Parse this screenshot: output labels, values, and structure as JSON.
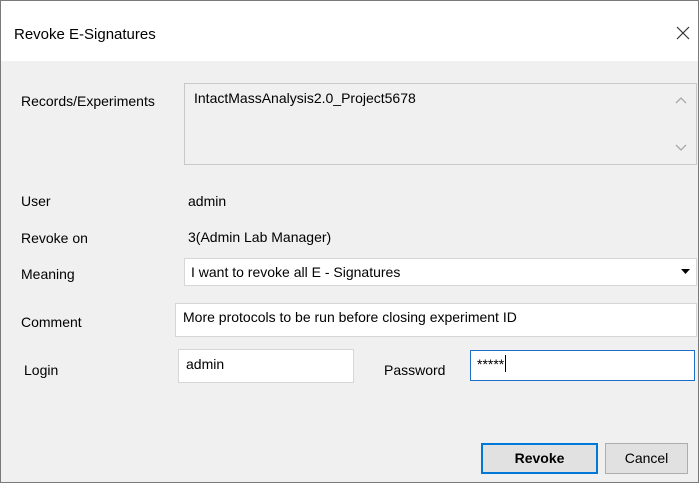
{
  "dialog": {
    "title": "Revoke E-Signatures"
  },
  "fields": {
    "records_label": "Records/Experiments",
    "records_value": "IntactMassAnalysis2.0_Project5678",
    "user_label": "User",
    "user_value": "admin",
    "revoke_on_label": "Revoke on",
    "revoke_on_value": "3(Admin Lab Manager)",
    "meaning_label": "Meaning",
    "meaning_value": "I want to revoke all E - Signatures",
    "comment_label": "Comment",
    "comment_value": "More protocols to be run before closing experiment ID",
    "login_label": "Login",
    "login_value": "admin",
    "password_label": "Password",
    "password_value": "*****"
  },
  "buttons": {
    "revoke": "Revoke",
    "cancel": "Cancel"
  },
  "colors": {
    "dialog_bg": "#f0f0f0",
    "focus_border": "#0078d7",
    "field_border": "#d6d6d6"
  },
  "icons": {
    "close": "close-icon",
    "dropdown": "dropdown-arrow-icon",
    "scroll_up": "scroll-up-icon",
    "scroll_down": "scroll-down-icon"
  }
}
